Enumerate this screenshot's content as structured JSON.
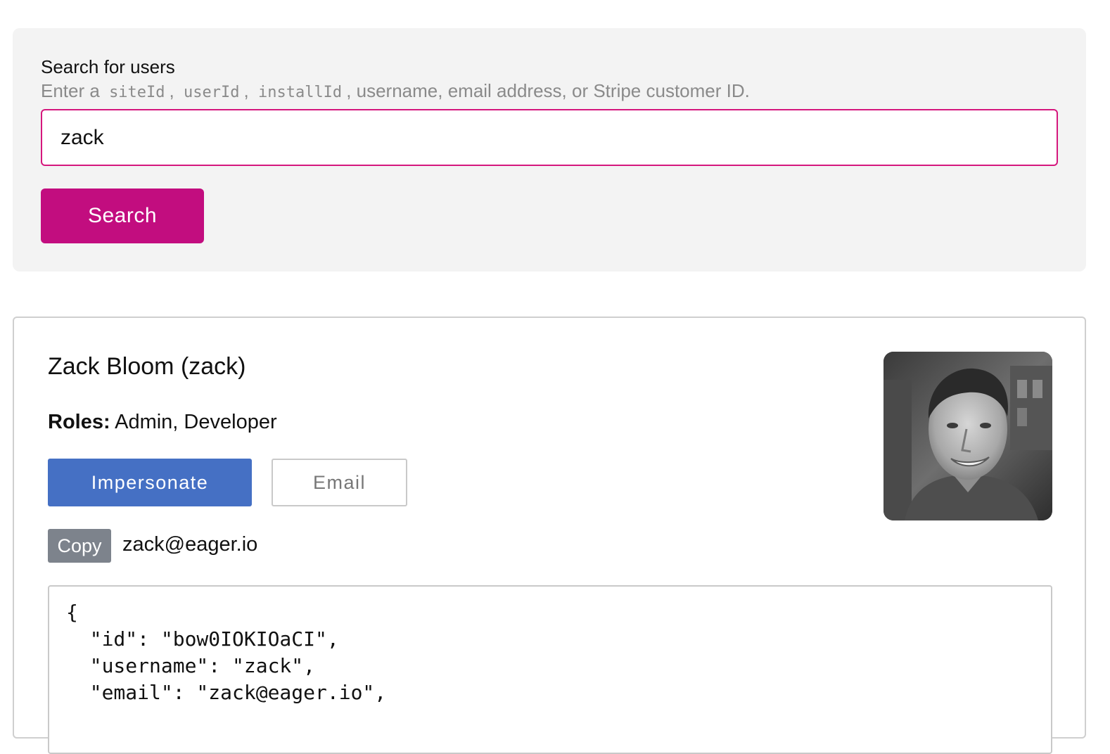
{
  "search": {
    "heading": "Search for users",
    "hint_prefix": "Enter a",
    "hint_token_1": "siteId",
    "hint_sep_1": ",",
    "hint_token_2": "userId",
    "hint_sep_2": ",",
    "hint_token_3": "installId",
    "hint_suffix": ", username, email address, or Stripe customer ID.",
    "input_value": "zack",
    "button_label": "Search"
  },
  "user": {
    "display_name": "Zack Bloom (zack)",
    "roles_label": "Roles:",
    "roles_value": "Admin, Developer",
    "impersonate_label": "Impersonate",
    "email_button_label": "Email",
    "copy_label": "Copy",
    "email": "zack@eager.io",
    "json_lines": [
      "{",
      "  \"id\": \"bow0IOKIOaCI\",",
      "  \"username\": \"zack\",",
      "  \"email\": \"zack@eager.io\","
    ]
  },
  "colors": {
    "accent": "#c20d7f",
    "input_border": "#d5177d",
    "impersonate": "#4570c4",
    "copy": "#7d838c",
    "panel_bg": "#f3f3f3"
  }
}
